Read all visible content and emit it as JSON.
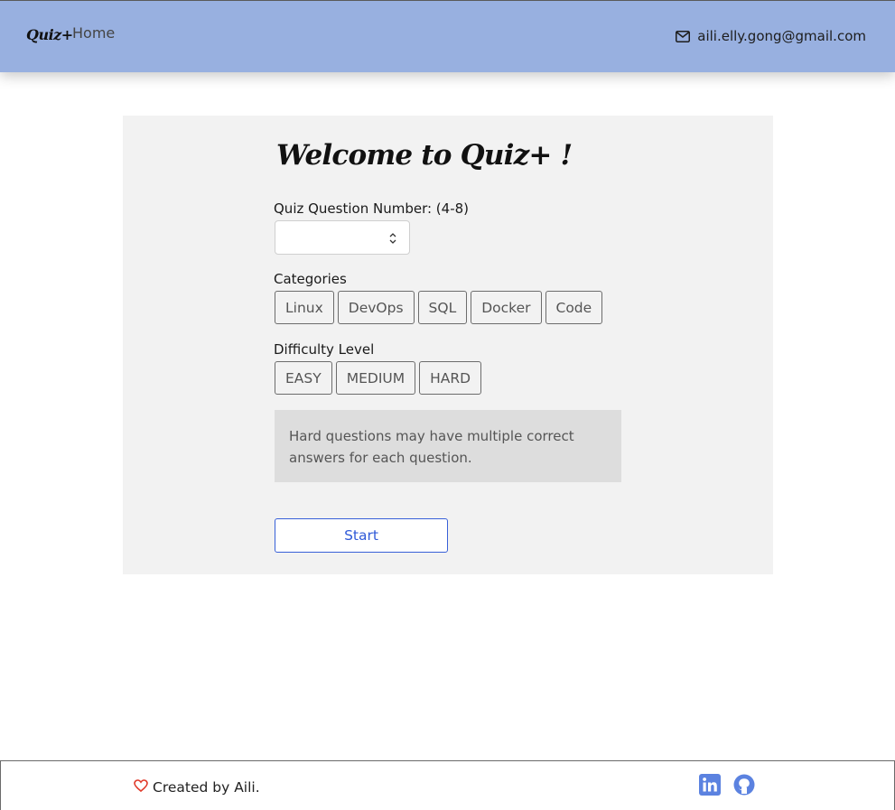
{
  "navbar": {
    "brand": "Quiz+",
    "home_label": "Home",
    "email": "aili.elly.gong@gmail.com",
    "email_icon": "envelope-icon"
  },
  "main": {
    "title": "Welcome to Quiz+ !",
    "question_number": {
      "label": "Quiz Question Number: (4-8)",
      "value": ""
    },
    "categories": {
      "label": "Categories",
      "options": [
        "Linux",
        "DevOps",
        "SQL",
        "Docker",
        "Code"
      ]
    },
    "difficulty": {
      "label": "Difficulty Level",
      "options": [
        "EASY",
        "MEDIUM",
        "HARD"
      ]
    },
    "note": "Hard questions may have multiple correct answers for each question.",
    "start_label": "Start"
  },
  "footer": {
    "credit": "Created by Aili.",
    "heart_icon": "heart-icon",
    "social": [
      "linkedin-icon",
      "github-icon"
    ]
  },
  "colors": {
    "navbar_bg": "#98b0e0",
    "card_bg": "#f2f2f2",
    "note_bg": "#dddddd",
    "accent": "#2f5ad8",
    "social_icon": "#5b82e0",
    "heart": "#e03a2a"
  }
}
